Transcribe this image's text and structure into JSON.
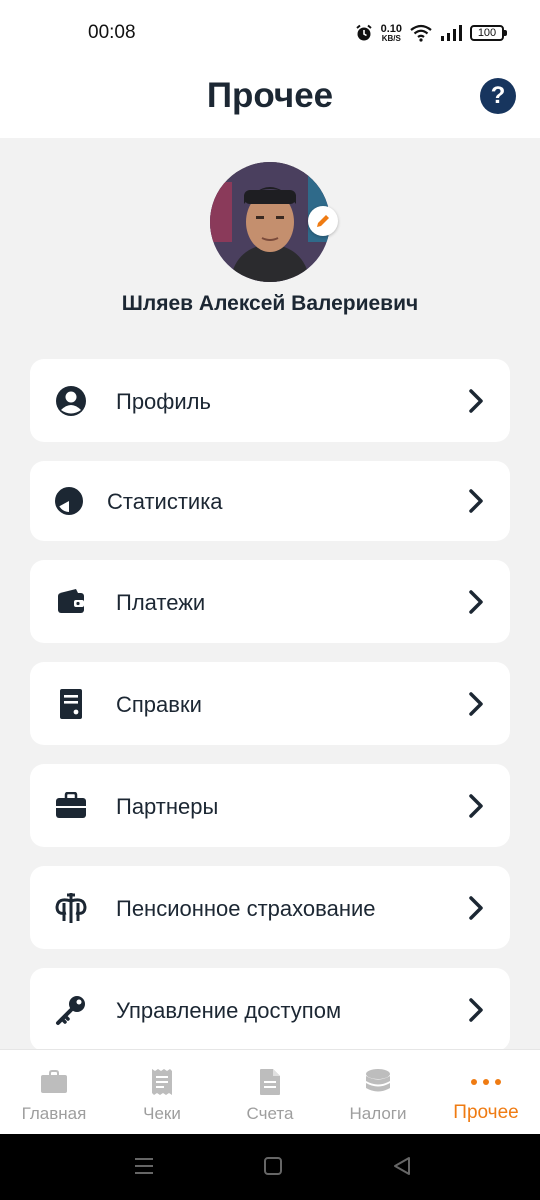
{
  "status": {
    "time": "00:08",
    "net_speed_value": "0.10",
    "net_speed_unit": "KB/S",
    "battery": "100"
  },
  "header": {
    "title": "Прочее",
    "help_label": "?"
  },
  "profile": {
    "name": "Шляев Алексей Валериевич"
  },
  "menu": {
    "items": [
      {
        "label": "Профиль",
        "icon": "account-circle-icon"
      },
      {
        "label": "Статистика",
        "icon": "pie-chart-icon"
      },
      {
        "label": "Платежи",
        "icon": "wallet-icon"
      },
      {
        "label": "Справки",
        "icon": "document-icon"
      },
      {
        "label": "Партнеры",
        "icon": "briefcase-icon"
      },
      {
        "label": "Пенсионное страхование",
        "icon": "pension-fund-icon"
      },
      {
        "label": "Управление доступом",
        "icon": "key-icon"
      }
    ]
  },
  "tabs": [
    {
      "label": "Главная",
      "icon": "briefcase-icon",
      "active": false
    },
    {
      "label": "Чеки",
      "icon": "receipt-icon",
      "active": false
    },
    {
      "label": "Счета",
      "icon": "invoice-icon",
      "active": false
    },
    {
      "label": "Налоги",
      "icon": "coins-icon",
      "active": false
    },
    {
      "label": "Прочее",
      "icon": "more-dots-icon",
      "active": true
    }
  ],
  "colors": {
    "accent": "#ef7b12",
    "dark": "#1c2733",
    "help_bg": "#17355e",
    "inactive": "#9e9e9e",
    "background": "#f2f2f2"
  }
}
